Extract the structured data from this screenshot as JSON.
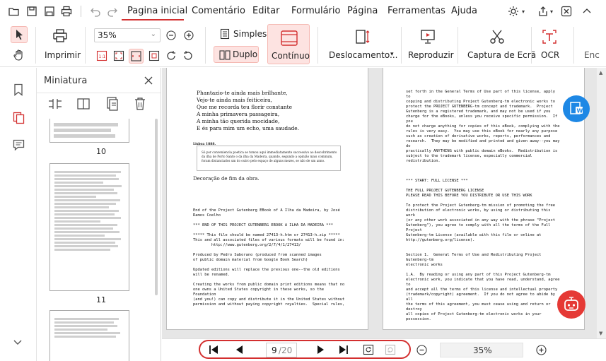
{
  "menu": {
    "items": [
      "Pagina inicial",
      "Comentário",
      "Editar",
      "Formulário",
      "Página",
      "Ferramentas",
      "Ajuda"
    ]
  },
  "ribbon": {
    "print_label": "Imprimir",
    "zoom_value": "35%",
    "simples_label": "Simples",
    "duplo_label": "Duplo",
    "continuo_label": "Contínuo",
    "deslocamento_label": "Deslocamento...",
    "reproduzir_label": "Reproduzir",
    "captura_label": "Captura de Ecrã",
    "ocr_label": "OCR",
    "overflow_label": "Enc"
  },
  "thumbnails": {
    "title": "Miniatura",
    "pages": [
      {
        "number": "10"
      },
      {
        "number": "11"
      }
    ]
  },
  "left_page": {
    "poem": [
      "Phantazio-te ainda mais brilhante,",
      "Vejo-te ainda mais feiticeira,",
      "Que me recorda teu florir constante",
      "A minha primavera passageira,",
      "A minha tão querida mocidade,",
      "E és para mim um echo, uma saudade."
    ],
    "place_date": "Lisboa 1888.",
    "footnote": "Só por conveniencia poetica se tomou aqui immediatamente successivo ao descobrimento da ilha de Porto Santo o da ilha da Madeira, quando, segundo a opinião mais commum, foram distanciados um do outro pelo espaço de alguns mezes, se não de um anno.",
    "decoration": "Decoração de fim da obra.",
    "mono_lines": [
      "End of the Project Gutenberg EBook of A Ilha da Madeira, by José",
      "Ramos Coelho",
      "",
      "*** END OF THIS PROJECT GUTENBERG EBOOK A ILHA DA MADEIRA ***",
      "",
      "***** This file should be named 27413-h.htm or 27413-h.zip *****",
      "This and all associated files of various formats will be found in:",
      "        http://www.gutenberg.org/2/7/4/1/27413/",
      "",
      "Produced by Pedro Saborano (produced from scanned images",
      "of public domain material from Google Book Search)",
      "",
      "Updated editions will replace the previous one--the old editions",
      "will be renamed.",
      "",
      "Creating the works from public domain print editions means that no",
      "one owns a United States copyright in these works, so the",
      "Foundation",
      "(and you!) can copy and distribute it in the United States without",
      "permission and without paying copyright royalties.  Special rules,"
    ]
  },
  "right_page": {
    "mono_lines": [
      "set forth in the General Terms of Use part of this license, apply",
      "to",
      "copying and distributing Project Gutenberg-tm electronic works to",
      "protect the PROJECT GUTENBERG-tm concept and trademark.  Project",
      "Gutenberg is a registered trademark, and may not be used if you",
      "charge for the eBooks, unless you receive specific permission.  If",
      "you",
      "do not charge anything for copies of this eBook, complying with the",
      "rules is very easy.  You may use this eBook for nearly any purpose",
      "such as creation of derivative works, reports, performances and",
      "research.  They may be modified and printed and given away--you may",
      "do",
      "practically ANYTHING with public domain eBooks.  Redistribution is",
      "subject to the trademark license, especially commercial",
      "redistribution.",
      "",
      "",
      "",
      "*** START: FULL LICENSE ***",
      "",
      "THE FULL PROJECT GUTENBERG LICENSE",
      "PLEASE READ THIS BEFORE YOU DISTRIBUTE OR USE THIS WORK",
      "",
      "To protect the Project Gutenberg-tm mission of promoting the free",
      "distribution of electronic works, by using or distributing this",
      "work",
      "(or any other work associated in any way with the phrase \"Project",
      "Gutenberg\"), you agree to comply with all the terms of the Full",
      "Project",
      "Gutenberg-tm License (available with this file or online at",
      "http://gutenberg.org/license).",
      "",
      "",
      "Section 1.  General Terms of Use and Redistributing Project",
      "Gutenberg-tm",
      "electronic works",
      "",
      "1.A.  By reading or using any part of this Project Gutenberg-tm",
      "electronic work, you indicate that you have read, understand, agree",
      "to",
      "and accept all the terms of this license and intellectual property",
      "(trademark/copyright) agreement.  If you do not agree to abide by",
      "all",
      "the terms of this agreement, you must cease using and return or",
      "destroy",
      "all copies of Project Gutenberg-tm electronic works in your",
      "possession."
    ]
  },
  "bottom": {
    "current_page": "9",
    "total_pages": "/20",
    "zoom_value": "35%"
  },
  "colors": {
    "accent": "#d32f2f",
    "highlight_bg": "#fde3e1",
    "badge_blue": "#1e88e5",
    "badge_red": "#e53935"
  }
}
